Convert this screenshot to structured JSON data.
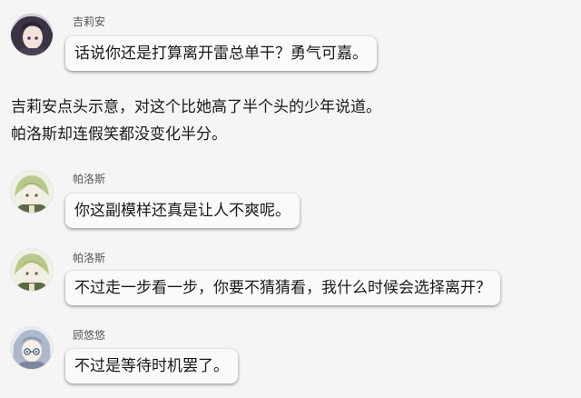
{
  "messages": [
    {
      "sender": "吉莉安",
      "text": "话说你还是打算离开雷总单干？勇气可嘉。",
      "avatar": "dark-haired-girl-avatar"
    },
    {
      "sender": "帕洛斯",
      "text": "你这副模样还真是让人不爽呢。",
      "avatar": "green-haired-boy-avatar"
    },
    {
      "sender": "帕洛斯",
      "text": "不过走一步看一步，你要不猜猜看，我什么时候会选择离开？",
      "avatar": "green-haired-boy-avatar"
    },
    {
      "sender": "顾悠悠",
      "text": "不过是等待时机罢了。",
      "avatar": "silver-haired-girl-avatar"
    }
  ],
  "narration": [
    "吉莉安点头示意，对这个比她高了半个头的少年说道。",
    "帕洛斯却连假笑都没变化半分。"
  ],
  "colors": {
    "background": "#f5f5f5",
    "bubble": "#fafafa",
    "sender_text": "#555555",
    "body_text": "#1a1a1a"
  }
}
